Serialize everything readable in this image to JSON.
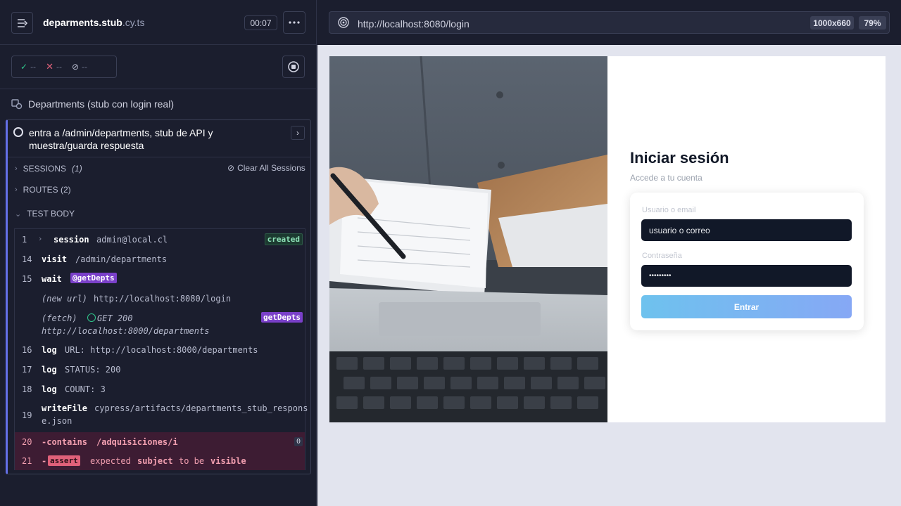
{
  "runner": {
    "file_name": "deparments.stub",
    "file_ext": ".cy.ts",
    "timer": "00:07",
    "stats": {
      "passed": "--",
      "failed": "--",
      "pending": "--"
    },
    "suite_title": "Departments (stub con login real)",
    "test_title": "entra a /admin/departments, stub de API y muestra/guarda respuesta",
    "sections": {
      "sessions_label": "SESSIONS",
      "sessions_count": "(1)",
      "clear_sessions": "Clear All Sessions",
      "routes_label": "ROUTES (2)",
      "test_body_label": "TEST BODY"
    },
    "commands": [
      {
        "num": "1",
        "name": "session",
        "arg": "admin@local.cl",
        "tag": "created"
      },
      {
        "num": "14",
        "name": "visit",
        "arg": "/admin/departments"
      },
      {
        "num": "15",
        "name": "wait",
        "alias": "@getDepts"
      },
      {
        "num": "",
        "name": "(new url)",
        "arg": "http://localhost:8080/login"
      },
      {
        "num": "",
        "name": "(fetch)",
        "method": "GET 200",
        "arg": "http://localhost:8000/departments",
        "alias": "getDepts"
      },
      {
        "num": "16",
        "name": "log",
        "arg": "URL: http://localhost:8000/departments"
      },
      {
        "num": "17",
        "name": "log",
        "arg": "STATUS: 200"
      },
      {
        "num": "18",
        "name": "log",
        "arg": "COUNT: 3"
      },
      {
        "num": "19",
        "name": "writeFile",
        "arg_line1": "cypress/artifacts/departments_stub_respons",
        "arg_line2": "e.json"
      },
      {
        "num": "20",
        "name": "-contains",
        "arg": "/adquisiciones/i",
        "count": "0"
      },
      {
        "num": "21",
        "prefix": "-",
        "name": "assert",
        "w1": "expected",
        "w2": "subject",
        "w3": "to be",
        "w4": "visible"
      }
    ]
  },
  "browser": {
    "url": "http://localhost:8080/login",
    "viewport_size": "1000x660",
    "zoom": "79%"
  },
  "login_page": {
    "title": "Iniciar sesión",
    "subtitle": "Accede a tu cuenta",
    "user_label": "Usuario o email",
    "user_value": "usuario o correo",
    "password_label": "Contraseña",
    "password_value": "•••••••••",
    "submit_label": "Entrar"
  }
}
